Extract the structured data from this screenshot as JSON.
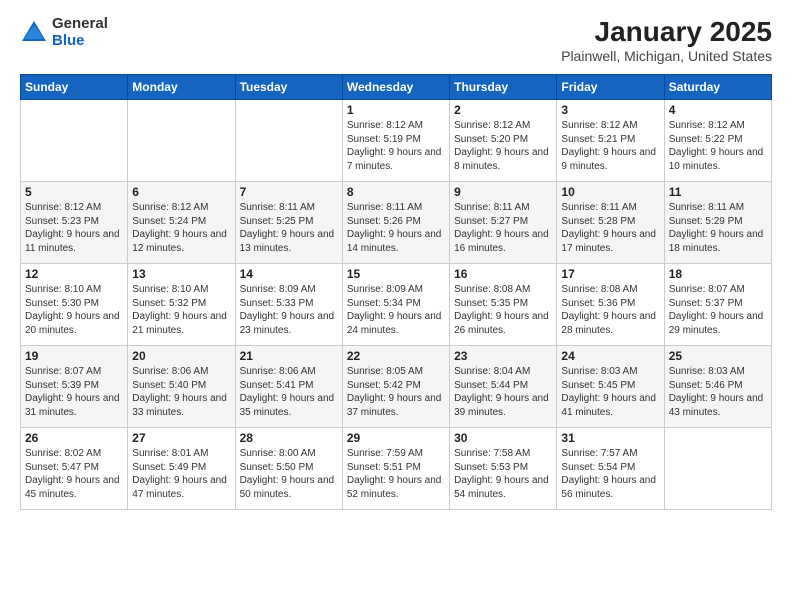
{
  "logo": {
    "general": "General",
    "blue": "Blue"
  },
  "header": {
    "title": "January 2025",
    "location": "Plainwell, Michigan, United States"
  },
  "days_of_week": [
    "Sunday",
    "Monday",
    "Tuesday",
    "Wednesday",
    "Thursday",
    "Friday",
    "Saturday"
  ],
  "weeks": [
    [
      {
        "day": "",
        "sunrise": "",
        "sunset": "",
        "daylight": ""
      },
      {
        "day": "",
        "sunrise": "",
        "sunset": "",
        "daylight": ""
      },
      {
        "day": "",
        "sunrise": "",
        "sunset": "",
        "daylight": ""
      },
      {
        "day": "1",
        "sunrise": "Sunrise: 8:12 AM",
        "sunset": "Sunset: 5:19 PM",
        "daylight": "Daylight: 9 hours and 7 minutes."
      },
      {
        "day": "2",
        "sunrise": "Sunrise: 8:12 AM",
        "sunset": "Sunset: 5:20 PM",
        "daylight": "Daylight: 9 hours and 8 minutes."
      },
      {
        "day": "3",
        "sunrise": "Sunrise: 8:12 AM",
        "sunset": "Sunset: 5:21 PM",
        "daylight": "Daylight: 9 hours and 9 minutes."
      },
      {
        "day": "4",
        "sunrise": "Sunrise: 8:12 AM",
        "sunset": "Sunset: 5:22 PM",
        "daylight": "Daylight: 9 hours and 10 minutes."
      }
    ],
    [
      {
        "day": "5",
        "sunrise": "Sunrise: 8:12 AM",
        "sunset": "Sunset: 5:23 PM",
        "daylight": "Daylight: 9 hours and 11 minutes."
      },
      {
        "day": "6",
        "sunrise": "Sunrise: 8:12 AM",
        "sunset": "Sunset: 5:24 PM",
        "daylight": "Daylight: 9 hours and 12 minutes."
      },
      {
        "day": "7",
        "sunrise": "Sunrise: 8:11 AM",
        "sunset": "Sunset: 5:25 PM",
        "daylight": "Daylight: 9 hours and 13 minutes."
      },
      {
        "day": "8",
        "sunrise": "Sunrise: 8:11 AM",
        "sunset": "Sunset: 5:26 PM",
        "daylight": "Daylight: 9 hours and 14 minutes."
      },
      {
        "day": "9",
        "sunrise": "Sunrise: 8:11 AM",
        "sunset": "Sunset: 5:27 PM",
        "daylight": "Daylight: 9 hours and 16 minutes."
      },
      {
        "day": "10",
        "sunrise": "Sunrise: 8:11 AM",
        "sunset": "Sunset: 5:28 PM",
        "daylight": "Daylight: 9 hours and 17 minutes."
      },
      {
        "day": "11",
        "sunrise": "Sunrise: 8:11 AM",
        "sunset": "Sunset: 5:29 PM",
        "daylight": "Daylight: 9 hours and 18 minutes."
      }
    ],
    [
      {
        "day": "12",
        "sunrise": "Sunrise: 8:10 AM",
        "sunset": "Sunset: 5:30 PM",
        "daylight": "Daylight: 9 hours and 20 minutes."
      },
      {
        "day": "13",
        "sunrise": "Sunrise: 8:10 AM",
        "sunset": "Sunset: 5:32 PM",
        "daylight": "Daylight: 9 hours and 21 minutes."
      },
      {
        "day": "14",
        "sunrise": "Sunrise: 8:09 AM",
        "sunset": "Sunset: 5:33 PM",
        "daylight": "Daylight: 9 hours and 23 minutes."
      },
      {
        "day": "15",
        "sunrise": "Sunrise: 8:09 AM",
        "sunset": "Sunset: 5:34 PM",
        "daylight": "Daylight: 9 hours and 24 minutes."
      },
      {
        "day": "16",
        "sunrise": "Sunrise: 8:08 AM",
        "sunset": "Sunset: 5:35 PM",
        "daylight": "Daylight: 9 hours and 26 minutes."
      },
      {
        "day": "17",
        "sunrise": "Sunrise: 8:08 AM",
        "sunset": "Sunset: 5:36 PM",
        "daylight": "Daylight: 9 hours and 28 minutes."
      },
      {
        "day": "18",
        "sunrise": "Sunrise: 8:07 AM",
        "sunset": "Sunset: 5:37 PM",
        "daylight": "Daylight: 9 hours and 29 minutes."
      }
    ],
    [
      {
        "day": "19",
        "sunrise": "Sunrise: 8:07 AM",
        "sunset": "Sunset: 5:39 PM",
        "daylight": "Daylight: 9 hours and 31 minutes."
      },
      {
        "day": "20",
        "sunrise": "Sunrise: 8:06 AM",
        "sunset": "Sunset: 5:40 PM",
        "daylight": "Daylight: 9 hours and 33 minutes."
      },
      {
        "day": "21",
        "sunrise": "Sunrise: 8:06 AM",
        "sunset": "Sunset: 5:41 PM",
        "daylight": "Daylight: 9 hours and 35 minutes."
      },
      {
        "day": "22",
        "sunrise": "Sunrise: 8:05 AM",
        "sunset": "Sunset: 5:42 PM",
        "daylight": "Daylight: 9 hours and 37 minutes."
      },
      {
        "day": "23",
        "sunrise": "Sunrise: 8:04 AM",
        "sunset": "Sunset: 5:44 PM",
        "daylight": "Daylight: 9 hours and 39 minutes."
      },
      {
        "day": "24",
        "sunrise": "Sunrise: 8:03 AM",
        "sunset": "Sunset: 5:45 PM",
        "daylight": "Daylight: 9 hours and 41 minutes."
      },
      {
        "day": "25",
        "sunrise": "Sunrise: 8:03 AM",
        "sunset": "Sunset: 5:46 PM",
        "daylight": "Daylight: 9 hours and 43 minutes."
      }
    ],
    [
      {
        "day": "26",
        "sunrise": "Sunrise: 8:02 AM",
        "sunset": "Sunset: 5:47 PM",
        "daylight": "Daylight: 9 hours and 45 minutes."
      },
      {
        "day": "27",
        "sunrise": "Sunrise: 8:01 AM",
        "sunset": "Sunset: 5:49 PM",
        "daylight": "Daylight: 9 hours and 47 minutes."
      },
      {
        "day": "28",
        "sunrise": "Sunrise: 8:00 AM",
        "sunset": "Sunset: 5:50 PM",
        "daylight": "Daylight: 9 hours and 50 minutes."
      },
      {
        "day": "29",
        "sunrise": "Sunrise: 7:59 AM",
        "sunset": "Sunset: 5:51 PM",
        "daylight": "Daylight: 9 hours and 52 minutes."
      },
      {
        "day": "30",
        "sunrise": "Sunrise: 7:58 AM",
        "sunset": "Sunset: 5:53 PM",
        "daylight": "Daylight: 9 hours and 54 minutes."
      },
      {
        "day": "31",
        "sunrise": "Sunrise: 7:57 AM",
        "sunset": "Sunset: 5:54 PM",
        "daylight": "Daylight: 9 hours and 56 minutes."
      },
      {
        "day": "",
        "sunrise": "",
        "sunset": "",
        "daylight": ""
      }
    ]
  ]
}
